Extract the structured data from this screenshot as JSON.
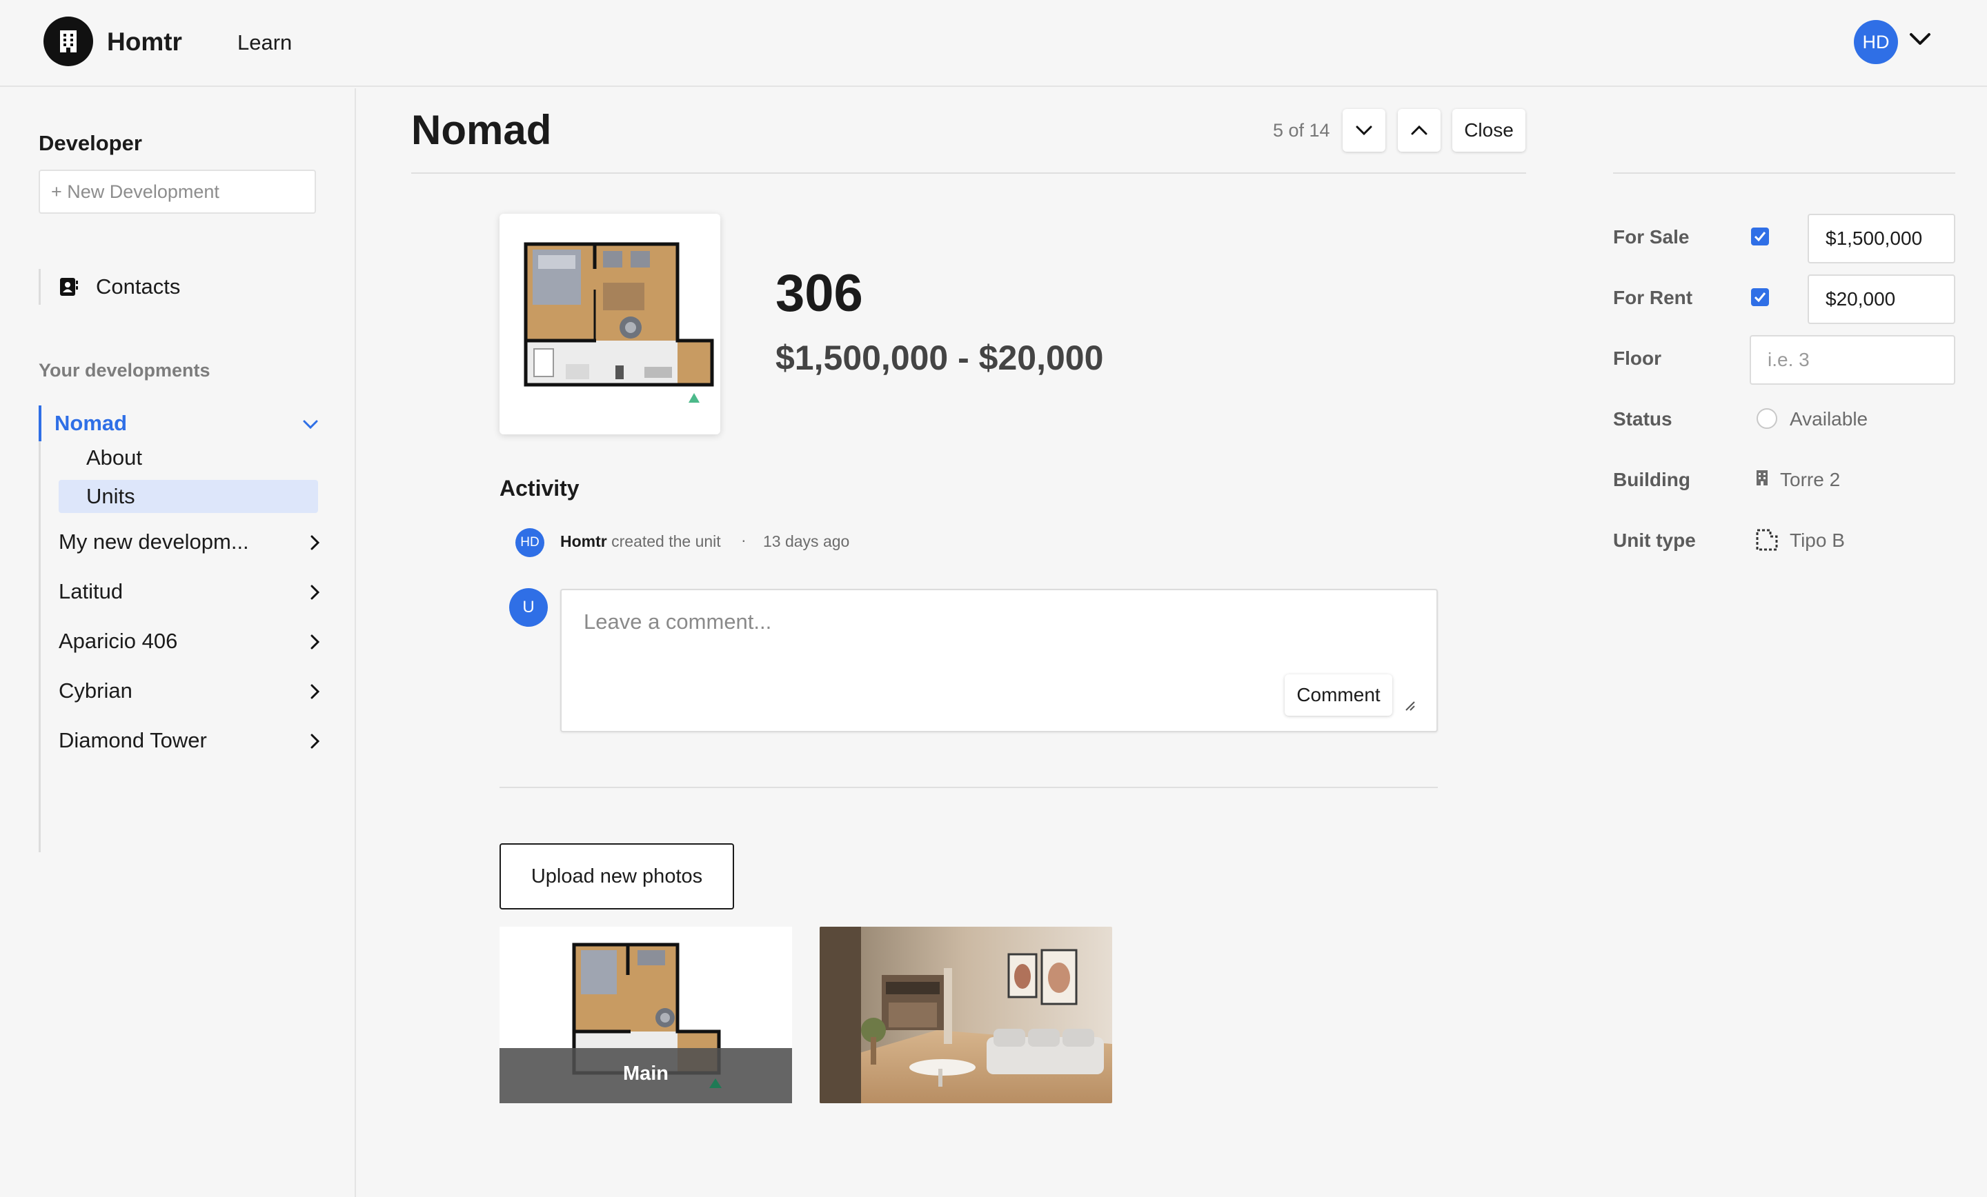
{
  "app": {
    "brand": "Homtr",
    "nav_learn": "Learn",
    "user_initials": "HD"
  },
  "sidebar": {
    "heading": "Developer",
    "new_development": "+ New Development",
    "contacts": "Contacts",
    "section_label": "Your developments",
    "developments": [
      {
        "label": "Nomad",
        "expanded": true,
        "children": [
          "About",
          "Units"
        ],
        "selected_child": "Units"
      },
      {
        "label": "My new developm..."
      },
      {
        "label": "Latitud"
      },
      {
        "label": "Aparicio 406"
      },
      {
        "label": "Cybrian"
      },
      {
        "label": "Diamond Tower"
      }
    ]
  },
  "header": {
    "title": "Nomad",
    "pager": "5 of 14",
    "close_label": "Close"
  },
  "unit": {
    "number": "306",
    "price_range": "$1,500,000 - $20,000"
  },
  "activity": {
    "heading": "Activity",
    "entries": [
      {
        "avatar": "HD",
        "actor": "Homtr",
        "action": "created the unit",
        "separator": "·",
        "time": "13 days ago"
      }
    ],
    "comment": {
      "user_initial": "U",
      "placeholder": "Leave a comment...",
      "button": "Comment"
    }
  },
  "photos": {
    "upload_label": "Upload new photos",
    "items": [
      {
        "kind": "floor-plan",
        "badge": "Main"
      },
      {
        "kind": "living-room-render"
      }
    ]
  },
  "properties": {
    "for_sale": {
      "label": "For Sale",
      "checked": true,
      "value": "$1,500,000"
    },
    "for_rent": {
      "label": "For Rent",
      "checked": true,
      "value": "$20,000"
    },
    "floor": {
      "label": "Floor",
      "value": "",
      "placeholder": "i.e. 3"
    },
    "status": {
      "label": "Status",
      "value": "Available"
    },
    "building": {
      "label": "Building",
      "value": "Torre 2",
      "icon": "building-icon"
    },
    "unit_type": {
      "label": "Unit type",
      "value": "Tipo B",
      "icon": "floorplan-icon"
    }
  },
  "colors": {
    "accent": "#2f6fe6",
    "selected_bg": "#dde6fa",
    "background": "#f6f6f6"
  }
}
